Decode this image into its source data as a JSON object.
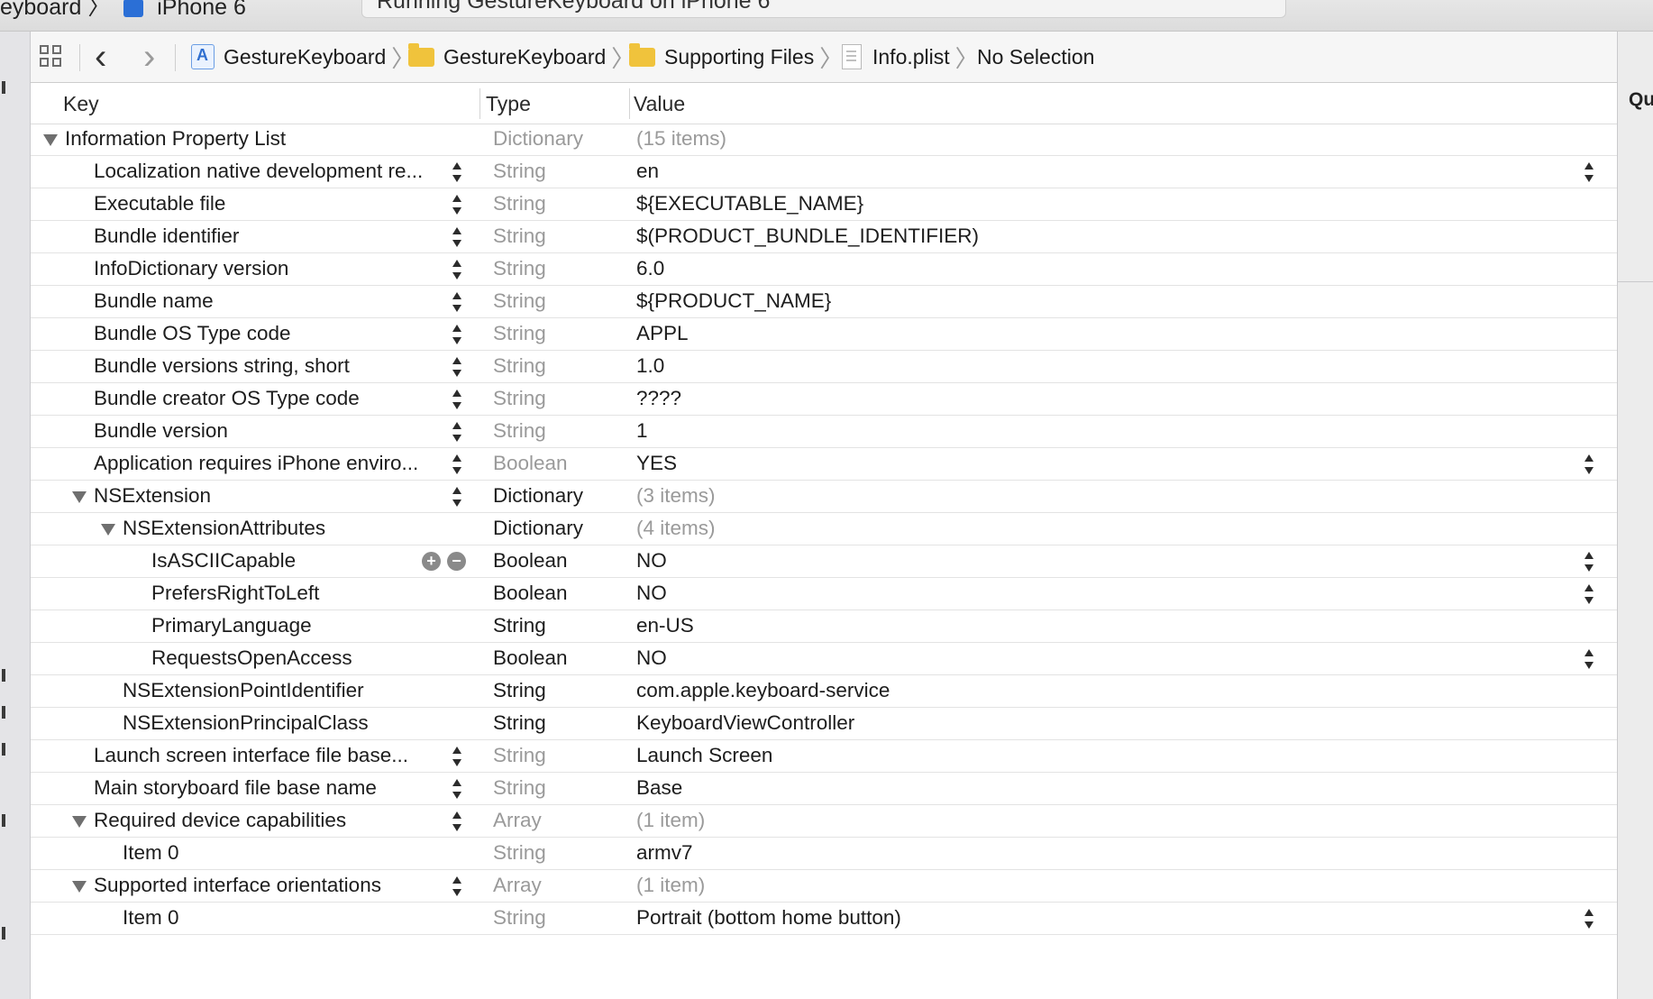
{
  "window": {
    "scheme_label": "eyboard",
    "scheme_separator": "〉",
    "device_label": "iPhone 6",
    "status_text": "Running GestureKeyboard on iPhone 6"
  },
  "jumpbar": {
    "chevron": "〉",
    "back_glyph": "‹",
    "forward_glyph": "›",
    "items": [
      {
        "label": "GestureKeyboard",
        "icon": "xcode-project-icon"
      },
      {
        "label": "GestureKeyboard",
        "icon": "folder-icon"
      },
      {
        "label": "Supporting Files",
        "icon": "folder-icon"
      },
      {
        "label": "Info.plist",
        "icon": "plist-file-icon"
      },
      {
        "label": "No Selection"
      }
    ]
  },
  "inspector": {
    "label": "Qu"
  },
  "editor": {
    "columns": {
      "key": "Key",
      "type": "Type",
      "value": "Value"
    },
    "glyphs": {
      "plus": "+",
      "minus": "−"
    },
    "rows": [
      {
        "key": "Information Property List",
        "type": "Dictionary",
        "value": "(15 items)"
      },
      {
        "key": "Localization native development re...",
        "type": "String",
        "value": "en"
      },
      {
        "key": "Executable file",
        "type": "String",
        "value": "${EXECUTABLE_NAME}"
      },
      {
        "key": "Bundle identifier",
        "type": "String",
        "value": "$(PRODUCT_BUNDLE_IDENTIFIER)"
      },
      {
        "key": "InfoDictionary version",
        "type": "String",
        "value": "6.0"
      },
      {
        "key": "Bundle name",
        "type": "String",
        "value": "${PRODUCT_NAME}"
      },
      {
        "key": "Bundle OS Type code",
        "type": "String",
        "value": "APPL"
      },
      {
        "key": "Bundle versions string, short",
        "type": "String",
        "value": "1.0"
      },
      {
        "key": "Bundle creator OS Type code",
        "type": "String",
        "value": "????"
      },
      {
        "key": "Bundle version",
        "type": "String",
        "value": "1"
      },
      {
        "key": "Application requires iPhone enviro...",
        "type": "Boolean",
        "value": "YES"
      },
      {
        "key": "NSExtension",
        "type": "Dictionary",
        "value": "(3 items)"
      },
      {
        "key": "NSExtensionAttributes",
        "type": "Dictionary",
        "value": "(4 items)"
      },
      {
        "key": "IsASCIICapable",
        "type": "Boolean",
        "value": "NO"
      },
      {
        "key": "PrefersRightToLeft",
        "type": "Boolean",
        "value": "NO"
      },
      {
        "key": "PrimaryLanguage",
        "type": "String",
        "value": "en-US"
      },
      {
        "key": "RequestsOpenAccess",
        "type": "Boolean",
        "value": "NO"
      },
      {
        "key": "NSExtensionPointIdentifier",
        "type": "String",
        "value": "com.apple.keyboard-service"
      },
      {
        "key": "NSExtensionPrincipalClass",
        "type": "String",
        "value": "KeyboardViewController"
      },
      {
        "key": "Launch screen interface file base...",
        "type": "String",
        "value": "Launch Screen"
      },
      {
        "key": "Main storyboard file base name",
        "type": "String",
        "value": "Base"
      },
      {
        "key": "Required device capabilities",
        "type": "Array",
        "value": "(1 item)"
      },
      {
        "key": "Item 0",
        "type": "String",
        "value": "armv7"
      },
      {
        "key": "Supported interface orientations",
        "type": "Array",
        "value": "(1 item)"
      },
      {
        "key": "Item 0",
        "type": "String",
        "value": "Portrait (bottom home button)"
      }
    ]
  }
}
